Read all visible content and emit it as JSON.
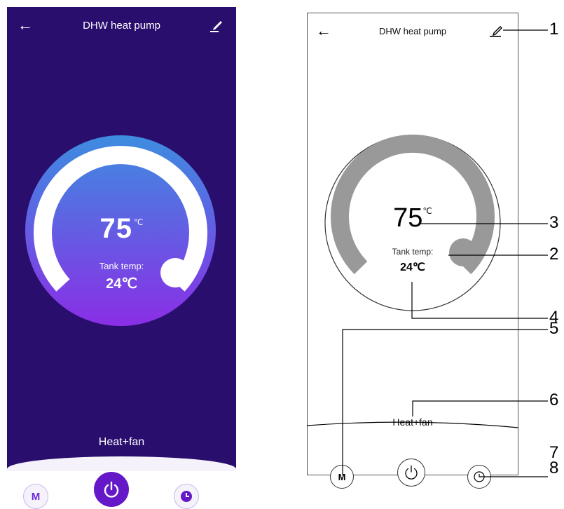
{
  "app": {
    "title": "DHW heat pump",
    "setpoint_value": "75",
    "setpoint_unit": "℃",
    "tank_label_left": "Tank temp:",
    "tank_label_right": "Tank temp:",
    "tank_value": "24℃",
    "mode": "Heat+fan",
    "mode_button_label": "M"
  },
  "icons": {
    "back": "back-arrow-icon",
    "edit": "edit-pencil-icon",
    "power": "power-icon",
    "clock": "clock-icon"
  },
  "colors": {
    "left_background": "#2a0e6e",
    "dial_gradient_top": "#3d8de0",
    "dial_gradient_bottom": "#8a2ee6",
    "accent": "#6418c8",
    "right_arc": "#999999"
  },
  "callouts": [
    "1",
    "2",
    "3",
    "4",
    "5",
    "6",
    "7",
    "8"
  ]
}
